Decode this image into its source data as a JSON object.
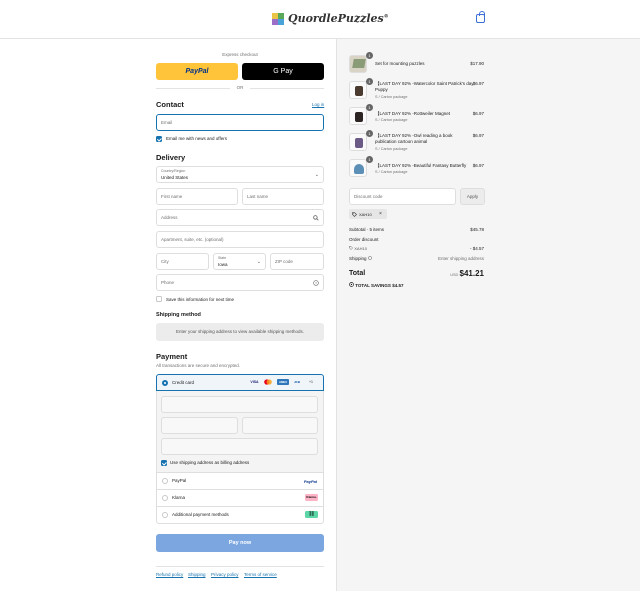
{
  "brand": {
    "name": "QuordlePuzzles",
    "trademark": "®",
    "logo_colors": [
      "#e8c547",
      "#5aa85a",
      "#9b6fc7",
      "#4aa3d8"
    ]
  },
  "express": {
    "title": "Express checkout",
    "or": "OR",
    "paypal_label": "PayPal",
    "gpay_label": "G Pay"
  },
  "contact": {
    "heading": "Contact",
    "login_link": "Log in",
    "email_placeholder": "Email",
    "newsletter_label": "Email me with news and offers",
    "newsletter_checked": true
  },
  "delivery": {
    "heading": "Delivery",
    "country_label": "Country/Region",
    "country_value": "United States",
    "first_name_placeholder": "First name",
    "last_name_placeholder": "Last name",
    "address_placeholder": "Address",
    "apartment_placeholder": "Apartment, suite, etc. (optional)",
    "city_placeholder": "City",
    "state_label": "State",
    "state_value": "Iowa",
    "zip_placeholder": "ZIP code",
    "phone_placeholder": "Phone",
    "save_info_label": "Save this information for next time"
  },
  "shipping_method": {
    "heading": "Shipping method",
    "message": "Enter your shipping address to view available shipping methods."
  },
  "payment": {
    "heading": "Payment",
    "subtitle": "All transactions are secure and encrypted.",
    "credit_card_label": "Credit card",
    "card_brands": [
      "VISA",
      "MC",
      "AMEX",
      "JCB"
    ],
    "more_cards": "+1",
    "billing_same_label": "Use shipping address as billing address",
    "paypal_label": "PayPal",
    "paypal_logo": "PayPal",
    "klarna_label": "Klarna",
    "klarna_logo": "Klarna.",
    "additional_label": "Additional payment methods",
    "pay_now": "Pay now",
    "accent": "#1773b0",
    "pay_button_color": "#7ba6e0"
  },
  "footer": {
    "links": [
      "Refund policy",
      "Shipping",
      "Privacy policy",
      "Terms of service"
    ]
  },
  "order": {
    "items": [
      {
        "qty": "1",
        "name": "Set for mounting puzzles",
        "variant": "",
        "price": "$17.90"
      },
      {
        "qty": "1",
        "name": "【LAST DAY 92% -Watercolor Saint Patrick's day Puppy",
        "variant": "S / Carton package",
        "price": "$6.97"
      },
      {
        "qty": "1",
        "name": "【LAST DAY 92% -Rottweiler Magnet",
        "variant": "S / Carton package",
        "price": "$6.97"
      },
      {
        "qty": "1",
        "name": "【LAST DAY 92% -Owl reading a book publication cartoon animal",
        "variant": "S / Carton package",
        "price": "$6.97"
      },
      {
        "qty": "1",
        "name": "【LAST DAY 92% -Beautiful Fantasy Butterfly",
        "variant": "S / Carton package",
        "price": "$6.97"
      }
    ],
    "discount_placeholder": "Discount code",
    "apply_label": "Apply",
    "applied_code": "XAH10",
    "subtotal_label": "Subtotal · 5 items",
    "subtotal_value": "$45.78",
    "order_discount_label": "Order discount",
    "discount_code": "XAH10",
    "discount_value": "- $4.57",
    "shipping_label": "Shipping",
    "shipping_value": "Enter shipping address",
    "total_label": "Total",
    "currency": "USD",
    "total_value": "$41.21",
    "savings_label": "TOTAL SAVINGS",
    "savings_value": "$4.57"
  }
}
